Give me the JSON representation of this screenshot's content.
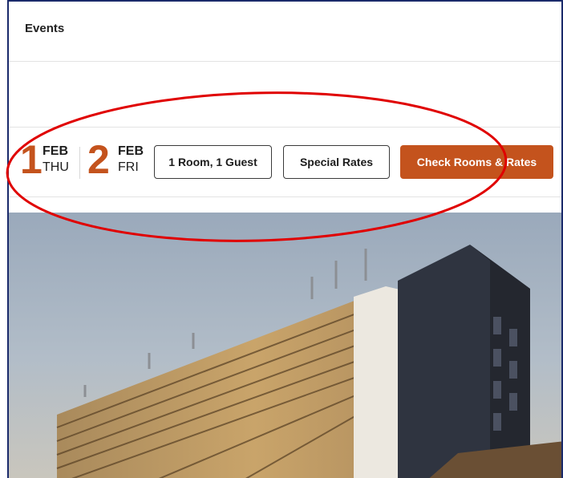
{
  "nav": {
    "events_label": "Events"
  },
  "booking": {
    "check_in": {
      "day": "1",
      "month": "FEB",
      "weekday": "THU"
    },
    "check_out": {
      "day": "2",
      "month": "FEB",
      "weekday": "FRI"
    },
    "guests_label": "1 Room, 1 Guest",
    "special_rates_label": "Special Rates",
    "check_rates_label": "Check Rooms & Rates"
  },
  "colors": {
    "accent": "#c4531d",
    "annotation": "#e00000",
    "frame_border": "#1a2a6b"
  },
  "hero": {
    "image_subject": "hotel-building-photo"
  }
}
